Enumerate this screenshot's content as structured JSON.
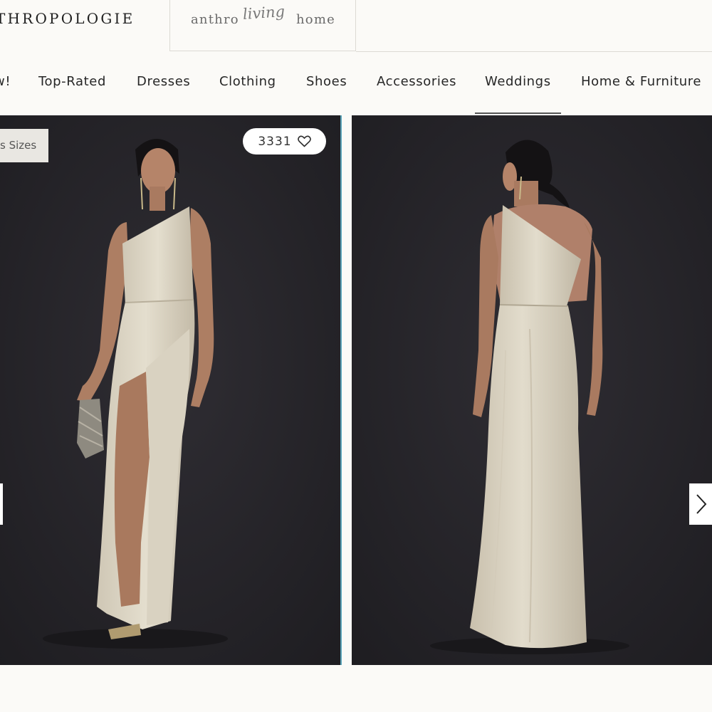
{
  "brand": {
    "logo": "THROPOLOGIE",
    "living_tab": {
      "part1": "anthro",
      "part2": "living",
      "part3": "home"
    }
  },
  "nav": {
    "items": [
      {
        "label": "w!"
      },
      {
        "label": "Top-Rated"
      },
      {
        "label": "Dresses"
      },
      {
        "label": "Clothing"
      },
      {
        "label": "Shoes"
      },
      {
        "label": "Accessories"
      },
      {
        "label": "Weddings",
        "active": true
      },
      {
        "label": "Home & Furniture"
      }
    ]
  },
  "gallery": {
    "badge": "s Sizes",
    "favorite_count": "3331",
    "icons": {
      "favorite": "heart-outline-icon",
      "prev": "chevron-left-icon",
      "next": "chevron-right-icon"
    },
    "colors": {
      "backdrop": "#27252a",
      "dress": "#ddd6c6",
      "skin": "#b08066",
      "hair": "#141214"
    }
  }
}
